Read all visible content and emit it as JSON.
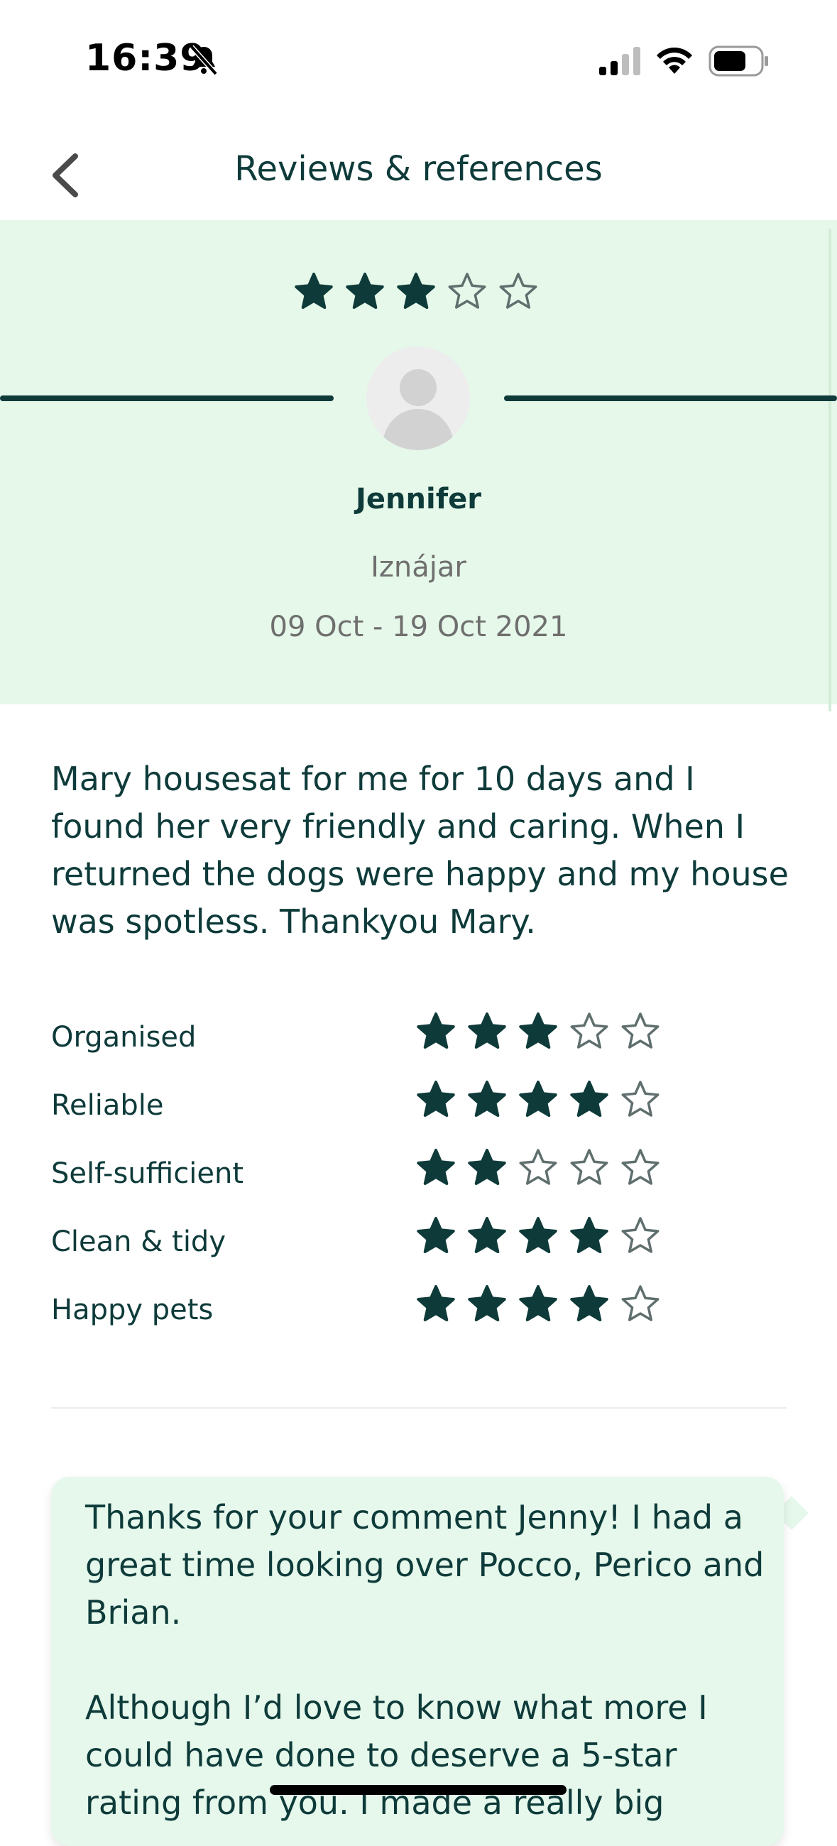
{
  "status_bar": {
    "time": "16:39"
  },
  "header": {
    "title": "Reviews & references"
  },
  "colors": {
    "accent": "#0e3b3a",
    "hero_bg": "#e6f8e9",
    "reply_bg": "#e6f8ec",
    "muted": "#6f6f6f"
  },
  "review": {
    "overall_rating": 3,
    "max_rating": 5,
    "reviewer_name": "Jennifer",
    "location": "Iznájar",
    "dates": "09 Oct - 19 Oct 2021",
    "text": "Mary housesat for me for 10 days and I found her very friendly and caring.  When I returned the dogs were happy and my house was spotless. Thankyou Mary.",
    "ratings": [
      {
        "label": "Organised",
        "value": 3
      },
      {
        "label": "Reliable",
        "value": 4
      },
      {
        "label": "Self-sufficient",
        "value": 2
      },
      {
        "label": "Clean & tidy",
        "value": 4
      },
      {
        "label": "Happy pets",
        "value": 4
      }
    ]
  },
  "reply": {
    "text": "Thanks for your comment Jenny! I had a great time looking over Pocco, Perico and Brian.\n\nAlthough I’d love to know what more I could have done to deserve a 5-star rating from you. I made a really big"
  }
}
